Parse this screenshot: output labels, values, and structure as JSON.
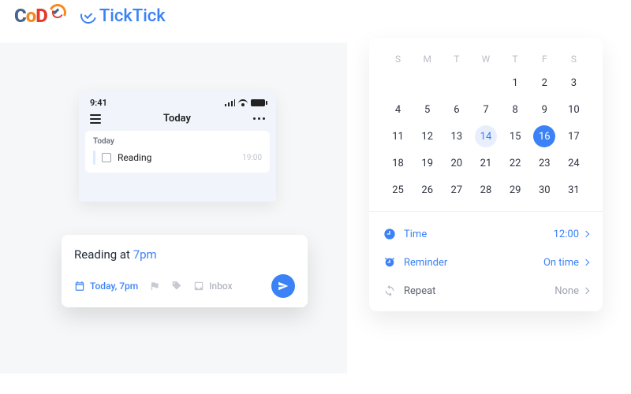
{
  "logos": {
    "codx": "CoD"
  },
  "app_name": "TickTick",
  "phone": {
    "clock": "9:41",
    "title": "Today",
    "section": "Today",
    "task_name": "Reading",
    "task_time": "19:00"
  },
  "compose": {
    "text_prefix": "Reading at ",
    "text_smart": "7pm",
    "date_chip": "Today, 7pm",
    "inbox_label": "Inbox"
  },
  "calendar": {
    "weekdays": [
      "S",
      "M",
      "T",
      "W",
      "T",
      "F",
      "S"
    ],
    "weeks": [
      [
        "",
        "",
        "",
        "1",
        "2",
        "3"
      ],
      [
        "4",
        "5",
        "6",
        "7",
        "8",
        "9",
        "10"
      ],
      [
        "11",
        "12",
        "13",
        "14",
        "15",
        "16",
        "17"
      ],
      [
        "18",
        "19",
        "20",
        "21",
        "22",
        "23",
        "24"
      ],
      [
        "25",
        "26",
        "27",
        "28",
        "29",
        "30",
        "31"
      ]
    ],
    "today": "14",
    "selected": "16",
    "options": {
      "time": {
        "label": "Time",
        "value": "12:00"
      },
      "reminder": {
        "label": "Reminder",
        "value": "On time"
      },
      "repeat": {
        "label": "Repeat",
        "value": "None"
      }
    }
  }
}
